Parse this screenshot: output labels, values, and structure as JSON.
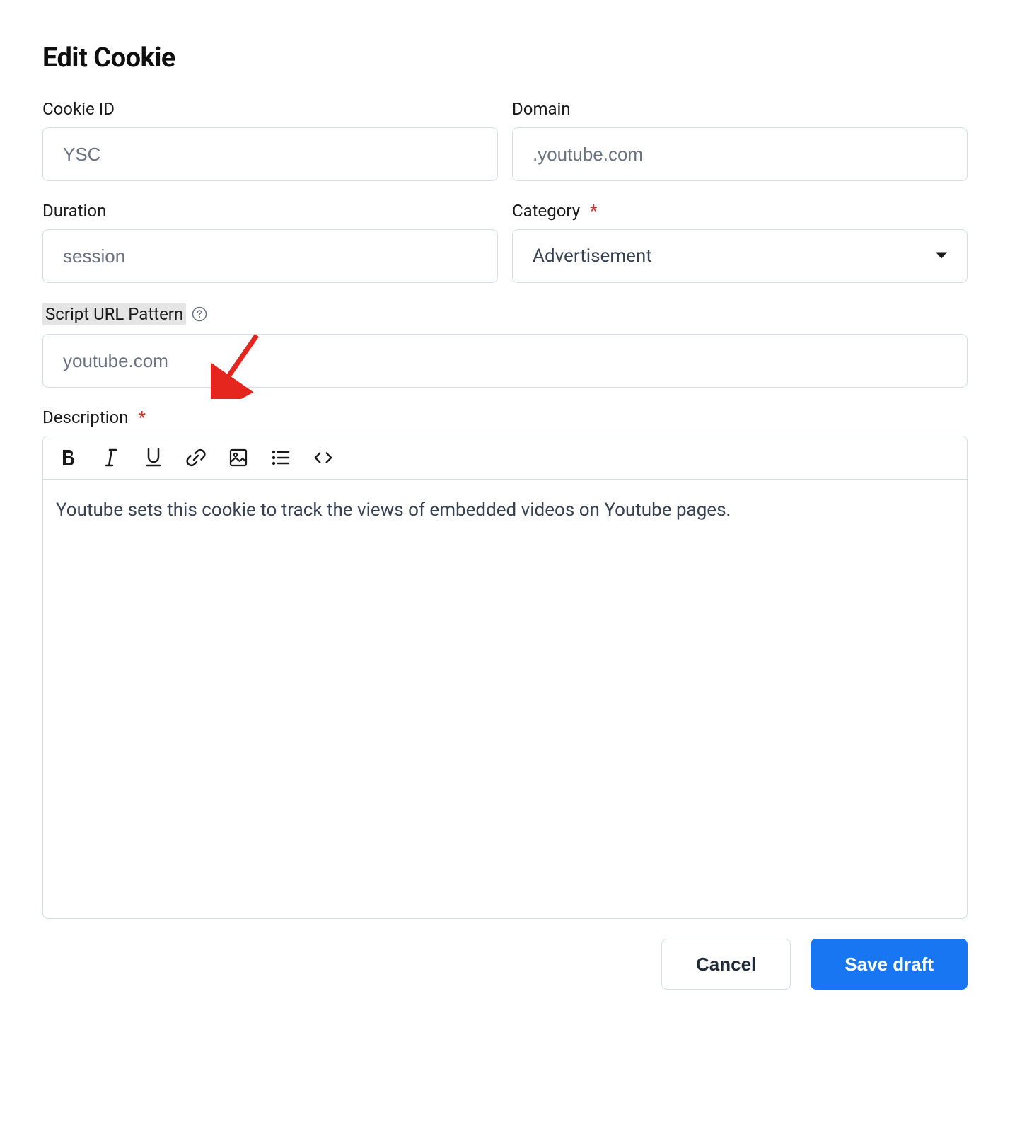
{
  "title": "Edit Cookie",
  "fields": {
    "cookie_id": {
      "label": "Cookie ID",
      "value": "YSC"
    },
    "domain": {
      "label": "Domain",
      "value": ".youtube.com"
    },
    "duration": {
      "label": "Duration",
      "value": "session"
    },
    "category": {
      "label": "Category",
      "value": "Advertisement"
    },
    "script_url_pattern": {
      "label": "Script URL Pattern",
      "value": "youtube.com"
    },
    "description": {
      "label": "Description",
      "value": "Youtube sets this cookie to track the views of embedded videos on Youtube pages."
    }
  },
  "buttons": {
    "cancel": "Cancel",
    "save_draft": "Save draft"
  }
}
